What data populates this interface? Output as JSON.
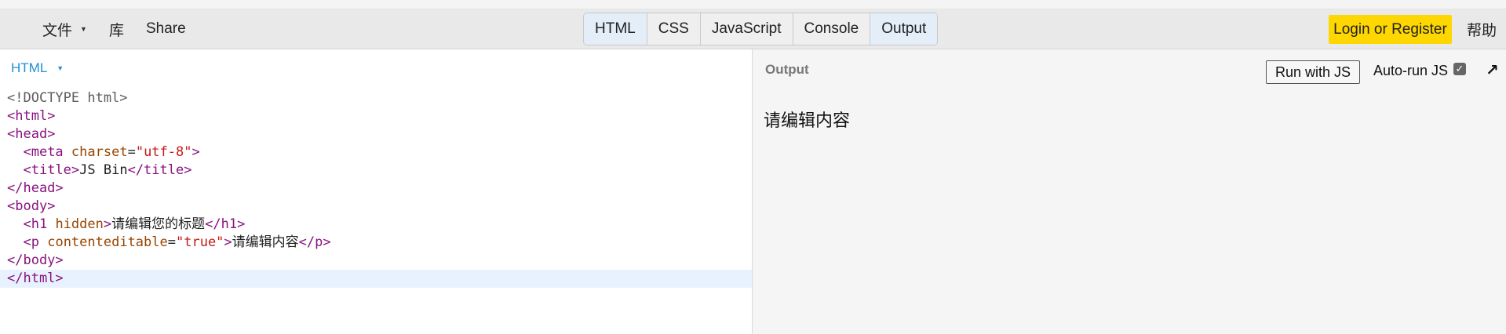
{
  "menu": {
    "file_label": "文件",
    "library_label": "库",
    "share_label": "Share"
  },
  "tabs": [
    {
      "label": "HTML",
      "active": true
    },
    {
      "label": "CSS",
      "active": false
    },
    {
      "label": "JavaScript",
      "active": false
    },
    {
      "label": "Console",
      "active": false
    },
    {
      "label": "Output",
      "active": true
    }
  ],
  "login_label": "Login or Register",
  "help_label": "帮助",
  "editor": {
    "language_label": "HTML",
    "code_lines": [
      "<!DOCTYPE html>",
      "<html>",
      "<head>",
      "  <meta charset=\"utf-8\">",
      "  <title>JS Bin</title>",
      "</head>",
      "<body>",
      "  <h1 hidden>请编辑您的标题</h1>",
      "  <p contenteditable=\"true\">请编辑内容</p>",
      "</body>",
      "</html>"
    ]
  },
  "output": {
    "label": "Output",
    "run_button_label": "Run with JS",
    "autorun_label": "Auto-run JS",
    "autorun_checked": true,
    "content_text": "请编辑内容"
  },
  "icons": {
    "caret": "caret-down-icon",
    "popout": "popout-arrow-icon",
    "check": "checkbox-check-icon"
  }
}
